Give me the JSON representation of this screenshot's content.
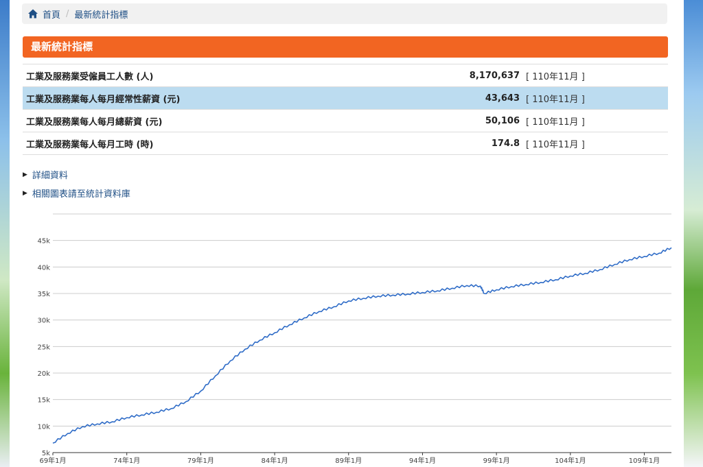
{
  "breadcrumb": {
    "home_icon": "home-icon",
    "home": "首頁",
    "separator": "/",
    "current": "最新統計指標"
  },
  "section": {
    "title": "最新統計指標"
  },
  "stats": [
    {
      "name": "工業及服務業受僱員工人數 (人)",
      "value": "8,170,637",
      "period": "[ 110年11月 ]",
      "highlighted": false
    },
    {
      "name": "工業及服務業每人每月經常性薪資 (元)",
      "value": "43,643",
      "period": "[ 110年11月 ]",
      "highlighted": true
    },
    {
      "name": "工業及服務業每人每月總薪資 (元)",
      "value": "50,106",
      "period": "[ 110年11月 ]",
      "highlighted": false
    },
    {
      "name": "工業及服務業每人每月工時 (時)",
      "value": "174.8",
      "period": "[ 110年11月 ]",
      "highlighted": false
    }
  ],
  "links": {
    "detail": "詳細資料",
    "related": "相關圖表請至統計資料庫"
  },
  "colors": {
    "accent": "#f26522",
    "highlight_row": "#bcdcf0",
    "link": "#1f4f85",
    "series_line": "#2f6cc7"
  },
  "chart_data": {
    "type": "line",
    "title": "",
    "xlabel": "",
    "ylabel": "",
    "ylim": [
      5000,
      50000
    ],
    "yticks": [
      5000,
      10000,
      15000,
      20000,
      25000,
      30000,
      35000,
      40000,
      45000
    ],
    "ytick_labels": [
      "5k",
      "10k",
      "15k",
      "20k",
      "25k",
      "30k",
      "35k",
      "40k",
      "45k"
    ],
    "xticks": [
      "69年1月",
      "74年1月",
      "79年1月",
      "84年1月",
      "89年1月",
      "94年1月",
      "99年1月",
      "104年1月",
      "109年1月"
    ],
    "grid": true,
    "x_start": "69年1月",
    "x_end": "110年11月",
    "series": [
      {
        "points": [
          [
            "69年1月",
            6800
          ],
          [
            "70年1月",
            8600
          ],
          [
            "71年1月",
            9900
          ],
          [
            "72年1月",
            10400
          ],
          [
            "73年1月",
            10800
          ],
          [
            "74年1月",
            11600
          ],
          [
            "75年1月",
            12100
          ],
          [
            "76年1月",
            12600
          ],
          [
            "77年1月",
            13300
          ],
          [
            "78年1月",
            14600
          ],
          [
            "79年1月",
            16600
          ],
          [
            "80年1月",
            19500
          ],
          [
            "81年1月",
            22300
          ],
          [
            "82年1月",
            24500
          ],
          [
            "83年1月",
            26200
          ],
          [
            "84年1月",
            27600
          ],
          [
            "85年1月",
            29100
          ],
          [
            "86年1月",
            30400
          ],
          [
            "87年1月",
            31600
          ],
          [
            "88年1月",
            32500
          ],
          [
            "89年1月",
            33600
          ],
          [
            "90年1月",
            34100
          ],
          [
            "91年1月",
            34500
          ],
          [
            "92年1月",
            34700
          ],
          [
            "93年1月",
            34900
          ],
          [
            "94年1月",
            35200
          ],
          [
            "95年1月",
            35500
          ],
          [
            "96年1月",
            36000
          ],
          [
            "97年1月",
            36500
          ],
          [
            "97年12月",
            36400
          ],
          [
            "98年3月",
            35000
          ],
          [
            "99年1月",
            35700
          ],
          [
            "100年1月",
            36300
          ],
          [
            "101年1月",
            36700
          ],
          [
            "102年1月",
            37100
          ],
          [
            "103年1月",
            37600
          ],
          [
            "104年1月",
            38300
          ],
          [
            "105年1月",
            38800
          ],
          [
            "106年1月",
            39500
          ],
          [
            "107年1月",
            40500
          ],
          [
            "108年1月",
            41400
          ],
          [
            "109年1月",
            42000
          ],
          [
            "110年1月",
            42600
          ],
          [
            "110年11月",
            43643
          ]
        ]
      }
    ]
  }
}
